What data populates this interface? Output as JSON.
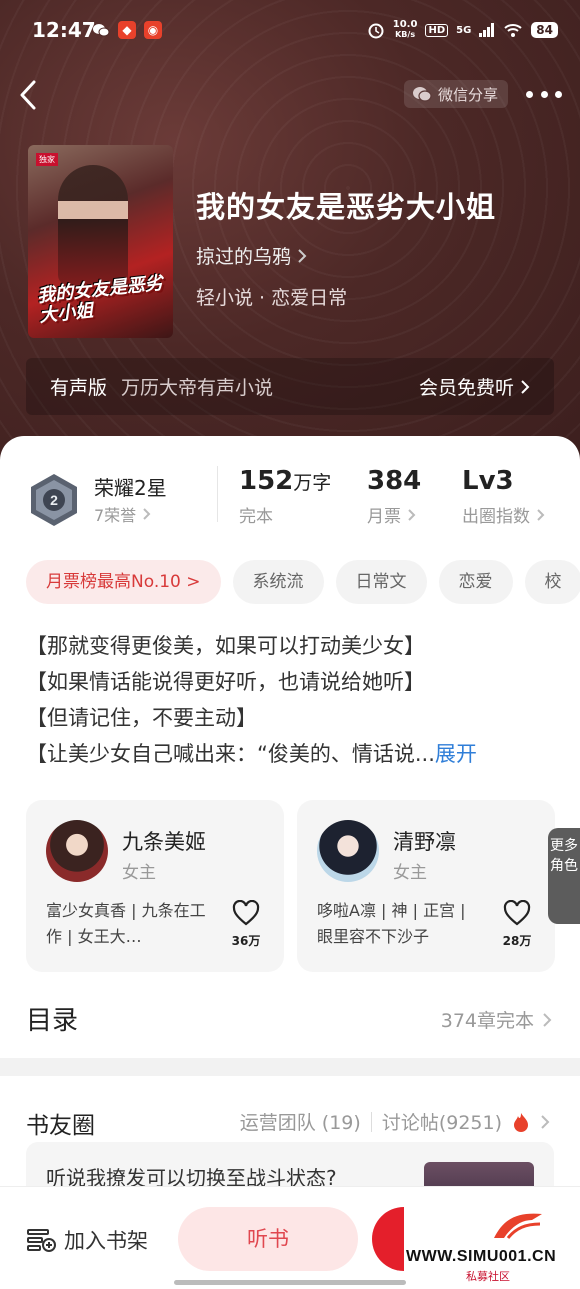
{
  "status_bar": {
    "time": "12:47",
    "net_speed_value": "10.0",
    "net_speed_unit": "KB/s",
    "hd": "HD",
    "signal": "5G",
    "battery": "84"
  },
  "nav": {
    "share_label": "微信分享"
  },
  "book": {
    "cover_title": "我的女友是恶劣大小姐",
    "cover_badge": "独家",
    "title": "我的女友是恶劣大小姐",
    "author": "掠过的乌鸦",
    "genre": "轻小说 · 恋爱日常"
  },
  "audio": {
    "label": "有声版",
    "description": "万历大帝有声小说",
    "action": "会员免费听"
  },
  "stats": {
    "rank_title": "荣耀2星",
    "rank_sub": "7荣誉",
    "words_value": "152",
    "words_unit": "万字",
    "words_label": "完本",
    "tickets_value": "384",
    "tickets_label": "月票",
    "level_value": "Lv3",
    "level_label": "出圈指数"
  },
  "tags": [
    "月票榜最高No.10 >",
    "系统流",
    "日常文",
    "恋爱",
    "校"
  ],
  "intro": {
    "lines": [
      "【那就变得更俊美，如果可以打动美少女】",
      "【如果情话能说得更好听，也请说给她听】",
      "【但请记住，不要主动】",
      "【让美少女自己喊出来：“俊美的、情话说..."
    ],
    "expand": "展开"
  },
  "roles": [
    {
      "name": "九条美姬",
      "role": "女主",
      "desc": "富少女真香 | 九条在工作 | 女王大…",
      "likes": "36万"
    },
    {
      "name": "清野凛",
      "role": "女主",
      "desc": "哆啦A凛 | 神 | 正宫 | 眼里容不下沙子",
      "likes": "28万"
    }
  ],
  "more_roles": "更多角色",
  "catalog": {
    "title": "目录",
    "count": "374章完本"
  },
  "circle": {
    "title": "书友圈",
    "team": "运营团队 (19)",
    "posts": "讨论帖(9251)",
    "first_post": "听说我撩发可以切换至战斗状态?"
  },
  "bottom_bar": {
    "shelf": "加入书架",
    "listen": "听书"
  },
  "watermark": {
    "site": "WWW.SIMU001.CN",
    "sub": "私募社区"
  },
  "colors": {
    "accent": "#e41f2b",
    "hero_bg": "#4c2826",
    "link": "#2f7ed8"
  }
}
